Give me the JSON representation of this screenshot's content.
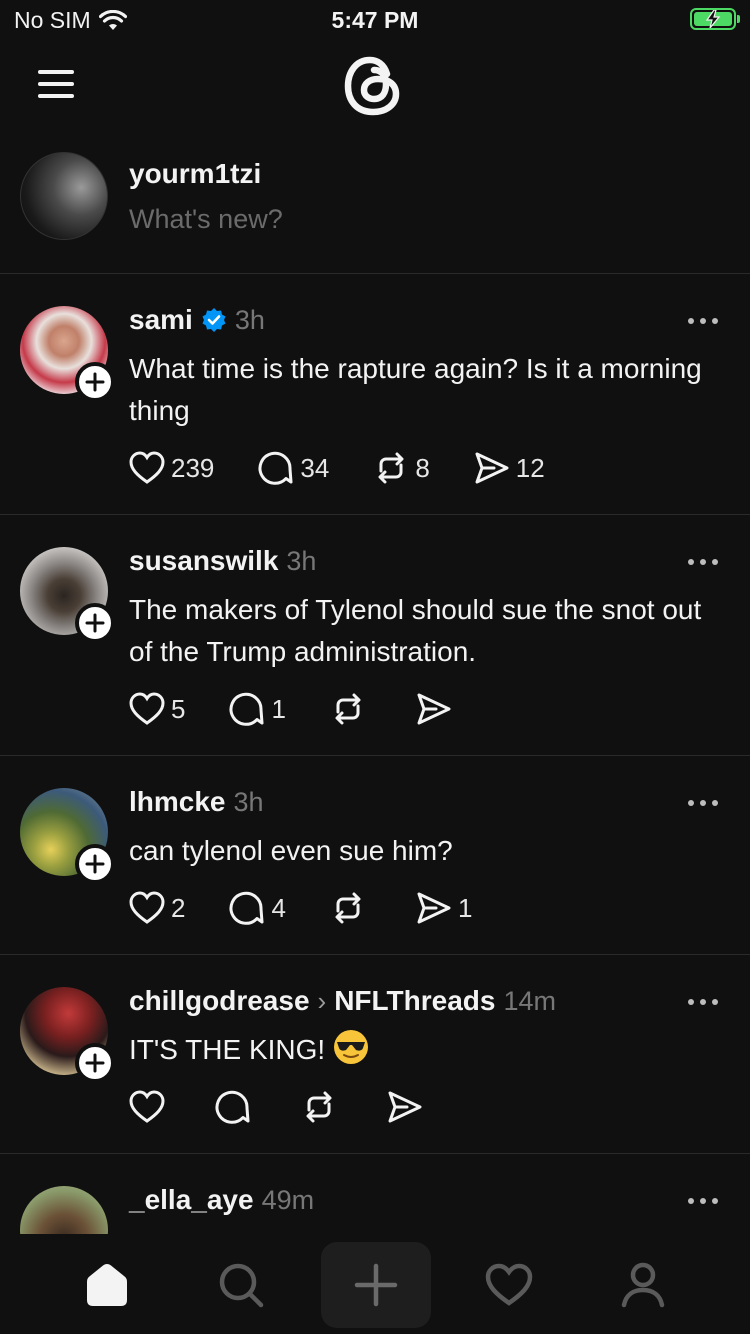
{
  "status_bar": {
    "carrier": "No SIM",
    "time": "5:47 PM",
    "battery_level": 1.0,
    "battery_charging": true,
    "wifi_icon": "wifi-icon"
  },
  "header": {
    "menu_icon": "hamburger-menu-icon",
    "logo": "threads-logo"
  },
  "composer": {
    "username": "yourm1tzi",
    "placeholder": "What's new?"
  },
  "posts": [
    {
      "username": "sami",
      "verified": true,
      "time": "3h",
      "text": "What time is the rapture again? Is it a morning thing",
      "likes": "239",
      "replies": "34",
      "reposts": "8",
      "shares": "12"
    },
    {
      "username": "susanswilk",
      "time": "3h",
      "text": "The makers of Tylenol should sue the snot out of the Trump administration.",
      "likes": "5",
      "replies": "1",
      "reposts": "",
      "shares": ""
    },
    {
      "username": "lhmcke",
      "time": "3h",
      "text": "can tylenol even sue him?",
      "likes": "2",
      "replies": "4",
      "reposts": "",
      "shares": "1"
    },
    {
      "username": "chillgodrease",
      "community": "NFLThreads",
      "time": "14m",
      "text": "IT'S THE KING!",
      "likes": "",
      "replies": "",
      "reposts": "",
      "shares": ""
    },
    {
      "username": "_ella_aye",
      "time": "49m"
    }
  ],
  "tab_bar": {
    "items": [
      "home-icon",
      "search-icon",
      "create-icon",
      "activity-heart-icon",
      "profile-icon"
    ],
    "active": "home-icon"
  },
  "colors": {
    "background": "#101010",
    "text": "#f3f3f3",
    "secondary": "#777777",
    "verified": "#0095f6",
    "battery": "#4cd964"
  }
}
